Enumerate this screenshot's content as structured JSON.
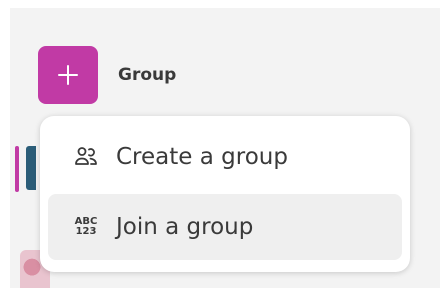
{
  "header": {
    "group_label": "Group"
  },
  "menu": {
    "items": [
      {
        "label": "Create a group",
        "icon": "users-icon"
      },
      {
        "label": "Join a group",
        "icon": "abc-123-icon",
        "icon_text": [
          "ABC",
          "123"
        ]
      }
    ]
  },
  "colors": {
    "accent": "#c13aa5",
    "panel": "#f3f3f3",
    "hover": "#efefef"
  }
}
